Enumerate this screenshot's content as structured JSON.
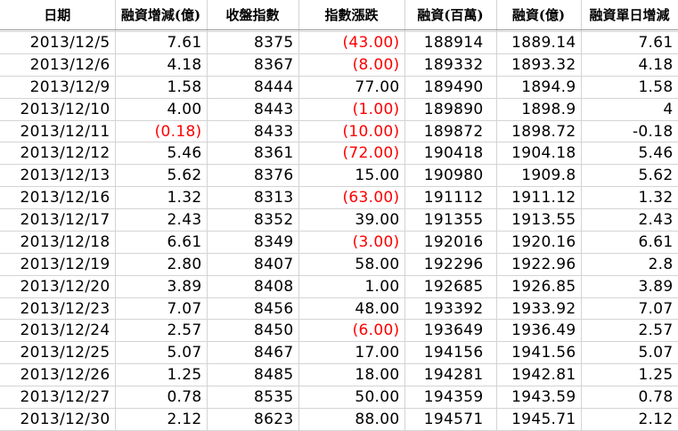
{
  "columns": [
    "日期",
    "融資增減(億)",
    "收盤指數",
    "指數漲跌",
    "融資(百萬)",
    "融資(億)",
    "融資單日增減"
  ],
  "rows": [
    {
      "date": "2013/12/5",
      "change_yi": "7.61",
      "close": "8375",
      "index_change": "(43.00)",
      "index_neg": true,
      "balance_m": "188914",
      "balance_yi": "1889.14",
      "daily": "7.61"
    },
    {
      "date": "2013/12/6",
      "change_yi": "4.18",
      "close": "8367",
      "index_change": "(8.00)",
      "index_neg": true,
      "balance_m": "189332",
      "balance_yi": "1893.32",
      "daily": "4.18"
    },
    {
      "date": "2013/12/9",
      "change_yi": "1.58",
      "close": "8444",
      "index_change": "77.00",
      "index_neg": false,
      "balance_m": "189490",
      "balance_yi": "1894.9",
      "daily": "1.58"
    },
    {
      "date": "2013/12/10",
      "change_yi": "4.00",
      "close": "8443",
      "index_change": "(1.00)",
      "index_neg": true,
      "balance_m": "189890",
      "balance_yi": "1898.9",
      "daily": "4"
    },
    {
      "date": "2013/12/11",
      "change_yi": "(0.18)",
      "change_neg": true,
      "close": "8433",
      "index_change": "(10.00)",
      "index_neg": true,
      "balance_m": "189872",
      "balance_yi": "1898.72",
      "daily": "-0.18"
    },
    {
      "date": "2013/12/12",
      "change_yi": "5.46",
      "close": "8361",
      "index_change": "(72.00)",
      "index_neg": true,
      "balance_m": "190418",
      "balance_yi": "1904.18",
      "daily": "5.46"
    },
    {
      "date": "2013/12/13",
      "change_yi": "5.62",
      "close": "8376",
      "index_change": "15.00",
      "index_neg": false,
      "balance_m": "190980",
      "balance_yi": "1909.8",
      "daily": "5.62"
    },
    {
      "date": "2013/12/16",
      "change_yi": "1.32",
      "close": "8313",
      "index_change": "(63.00)",
      "index_neg": true,
      "balance_m": "191112",
      "balance_yi": "1911.12",
      "daily": "1.32"
    },
    {
      "date": "2013/12/17",
      "change_yi": "2.43",
      "close": "8352",
      "index_change": "39.00",
      "index_neg": false,
      "balance_m": "191355",
      "balance_yi": "1913.55",
      "daily": "2.43"
    },
    {
      "date": "2013/12/18",
      "change_yi": "6.61",
      "close": "8349",
      "index_change": "(3.00)",
      "index_neg": true,
      "balance_m": "192016",
      "balance_yi": "1920.16",
      "daily": "6.61"
    },
    {
      "date": "2013/12/19",
      "change_yi": "2.80",
      "close": "8407",
      "index_change": "58.00",
      "index_neg": false,
      "balance_m": "192296",
      "balance_yi": "1922.96",
      "daily": "2.8"
    },
    {
      "date": "2013/12/20",
      "change_yi": "3.89",
      "close": "8408",
      "index_change": "1.00",
      "index_neg": false,
      "balance_m": "192685",
      "balance_yi": "1926.85",
      "daily": "3.89"
    },
    {
      "date": "2013/12/23",
      "change_yi": "7.07",
      "close": "8456",
      "index_change": "48.00",
      "index_neg": false,
      "balance_m": "193392",
      "balance_yi": "1933.92",
      "daily": "7.07"
    },
    {
      "date": "2013/12/24",
      "change_yi": "2.57",
      "close": "8450",
      "index_change": "(6.00)",
      "index_neg": true,
      "balance_m": "193649",
      "balance_yi": "1936.49",
      "daily": "2.57"
    },
    {
      "date": "2013/12/25",
      "change_yi": "5.07",
      "close": "8467",
      "index_change": "17.00",
      "index_neg": false,
      "balance_m": "194156",
      "balance_yi": "1941.56",
      "daily": "5.07"
    },
    {
      "date": "2013/12/26",
      "change_yi": "1.25",
      "close": "8485",
      "index_change": "18.00",
      "index_neg": false,
      "balance_m": "194281",
      "balance_yi": "1942.81",
      "daily": "1.25"
    },
    {
      "date": "2013/12/27",
      "change_yi": "0.78",
      "close": "8535",
      "index_change": "50.00",
      "index_neg": false,
      "balance_m": "194359",
      "balance_yi": "1943.59",
      "daily": "0.78"
    },
    {
      "date": "2013/12/30",
      "change_yi": "2.12",
      "close": "8623",
      "index_change": "88.00",
      "index_neg": false,
      "balance_m": "194571",
      "balance_yi": "1945.71",
      "daily": "2.12"
    }
  ],
  "colors": {
    "negative": "#ff0000",
    "text": "#000000",
    "grid": "#d4d4d4"
  }
}
